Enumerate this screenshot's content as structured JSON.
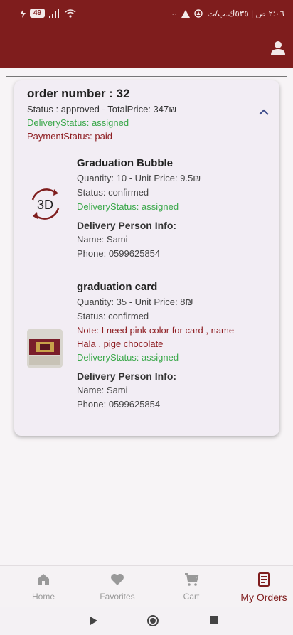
{
  "status_bar": {
    "left_icons": [
      "charging-icon",
      "battery-icon",
      "signal-icon",
      "wifi-icon"
    ],
    "battery_level": "49",
    "right_text": "٢:٠٦ ص | ٥٣٥ك.ب/ث",
    "right_icons": [
      "dots-icon",
      "warning-icon",
      "app-icon"
    ]
  },
  "app_bar": {
    "icon": "user-icon",
    "color": "#7f1d1d"
  },
  "order": {
    "title": "order number : 32",
    "status_line": "Status : approved - TotalPrice: 347₪",
    "delivery_status": "DeliveryStatus: assigned",
    "payment_status": "PaymentStatus: paid",
    "items": [
      {
        "name": "Graduation Bubble",
        "qty_line": "Quantity: 10 - Unit Price: 9.5₪",
        "status": "Status: confirmed",
        "delivery_status": "DeliveryStatus: assigned",
        "person_heading": "Delivery Person Info:",
        "person_name": "Name: Sami",
        "person_phone": "Phone: 0599625854",
        "thumb": "3d-rotate-icon"
      },
      {
        "name": "graduation card",
        "qty_line": "Quantity: 35  - Unit Price: 8₪",
        "status": "Status: confirmed",
        "note_line1": "Note: I need pink color for card , name",
        "note_line2": "Hala , pige chocolate",
        "delivery_status": "DeliveryStatus: assigned",
        "person_heading": "Delivery Person Info:",
        "person_name": "Name: Sami",
        "person_phone": "Phone: 0599625854",
        "thumb": "product-photo"
      }
    ]
  },
  "nav": {
    "items": [
      {
        "label": "Home",
        "icon": "home-icon"
      },
      {
        "label": "Favorites",
        "icon": "heart-icon"
      },
      {
        "label": "Cart",
        "icon": "cart-icon"
      },
      {
        "label": "My Orders",
        "icon": "orders-icon",
        "active": true
      }
    ]
  },
  "colors": {
    "primary": "#7f1d1d",
    "success": "#3aa84a",
    "warning_text": "#8e1e22"
  }
}
